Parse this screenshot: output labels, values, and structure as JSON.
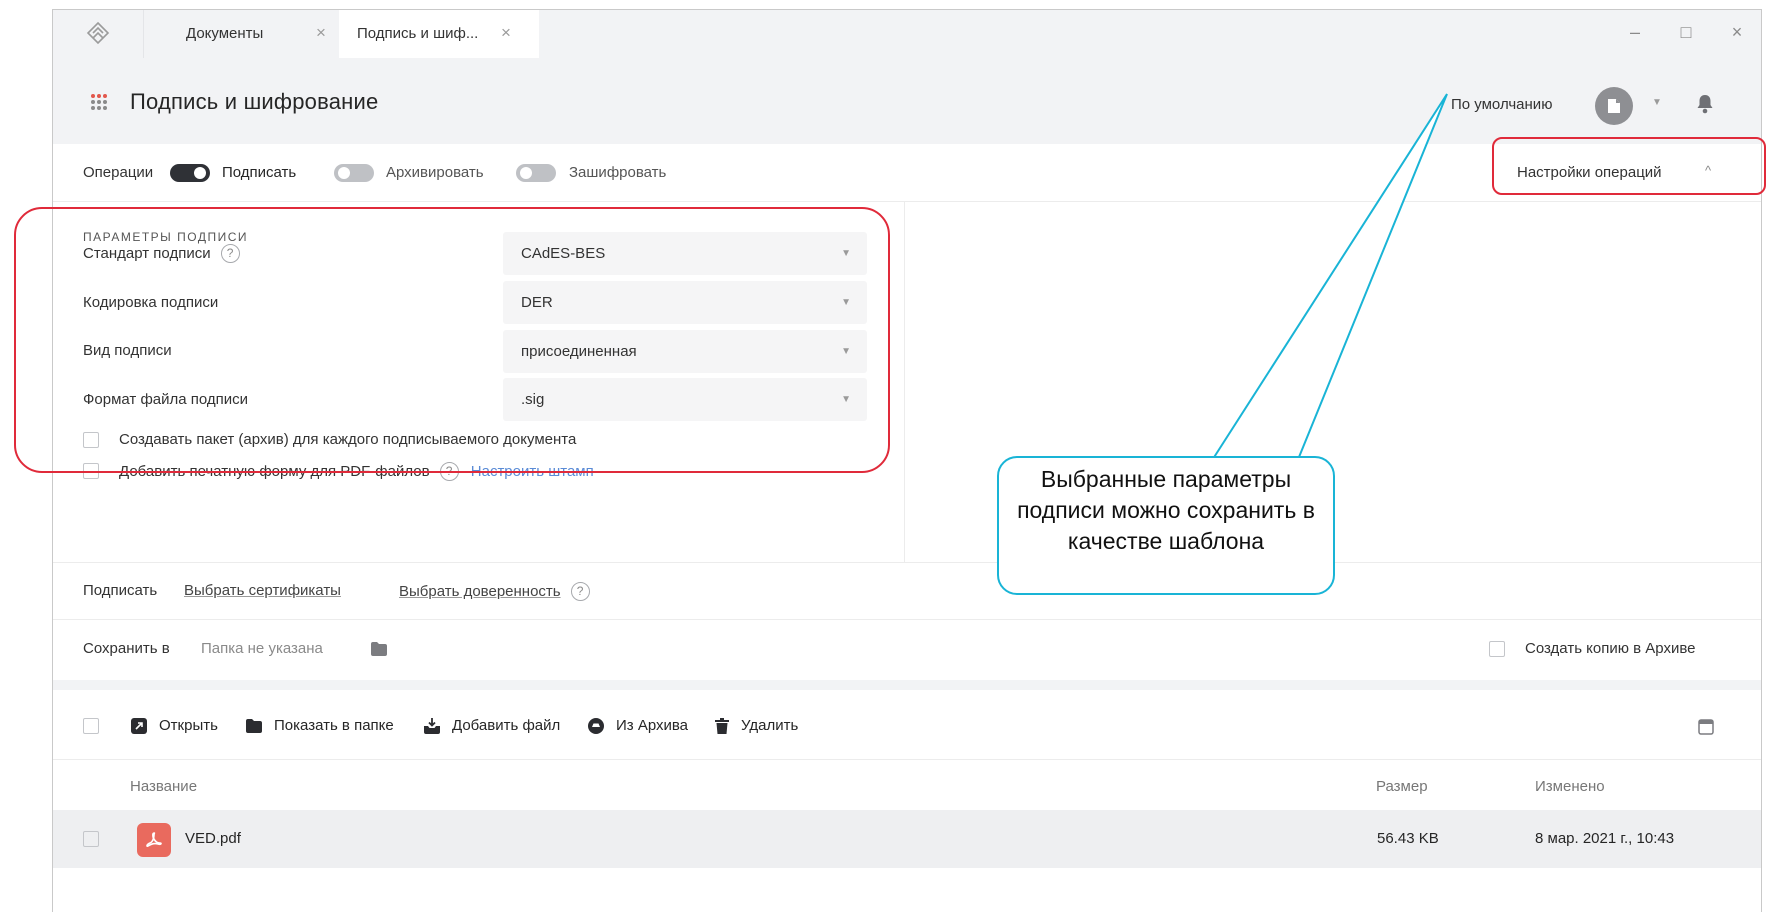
{
  "tabs": [
    {
      "label": "Документы",
      "close": "×"
    },
    {
      "label": "Подпись и шиф...",
      "close": "×"
    }
  ],
  "window_controls": {
    "minimize": "–",
    "maximize": "□",
    "close": "×"
  },
  "header": {
    "title": "Подпись и шифрование",
    "profile_label": "По умолчанию"
  },
  "operations": {
    "label": "Операции",
    "toggles": [
      {
        "label": "Подписать",
        "on": true
      },
      {
        "label": "Архивировать",
        "on": false
      },
      {
        "label": "Зашифровать",
        "on": false
      }
    ],
    "settings_label": "Настройки операций"
  },
  "params": {
    "section_title": "ПАРАМЕТРЫ ПОДПИСИ",
    "rows": [
      {
        "label": "Стандарт подписи",
        "value": "CAdES-BES"
      },
      {
        "label": "Кодировка подписи",
        "value": "DER"
      },
      {
        "label": "Вид подписи",
        "value": "присоединенная"
      },
      {
        "label": "Формат файла подписи",
        "value": ".sig"
      }
    ],
    "help_glyph": "?",
    "checkbox_archive": "Создавать пакет (архив) для каждого подписываемого документа",
    "checkbox_print": "Добавить печатную форму для PDF-файлов",
    "stamp_link": "Настроить штамп"
  },
  "sign_row": {
    "label": "Подписать",
    "select_cert": "Выбрать сертификаты",
    "select_proxy": "Выбрать доверенность"
  },
  "save_row": {
    "label": "Сохранить в",
    "folder": "Папка не указана",
    "copy_archive": "Создать копию в Архиве"
  },
  "toolbar": {
    "open": "Открыть",
    "show_in_folder": "Показать в папке",
    "add_file": "Добавить файл",
    "from_archive": "Из Архива",
    "delete": "Удалить"
  },
  "table": {
    "columns": [
      "Название",
      "Размер",
      "Изменено"
    ],
    "rows": [
      {
        "name": "VED.pdf",
        "size": "56.43 KB",
        "modified": "8 мар. 2021 г., 10:43"
      }
    ]
  },
  "annotation": {
    "text": "Выбранные параметры подписи можно сохранить в качестве шаблона",
    "callout_color": "#19b4d6",
    "highlight_color": "#e02a3a"
  }
}
